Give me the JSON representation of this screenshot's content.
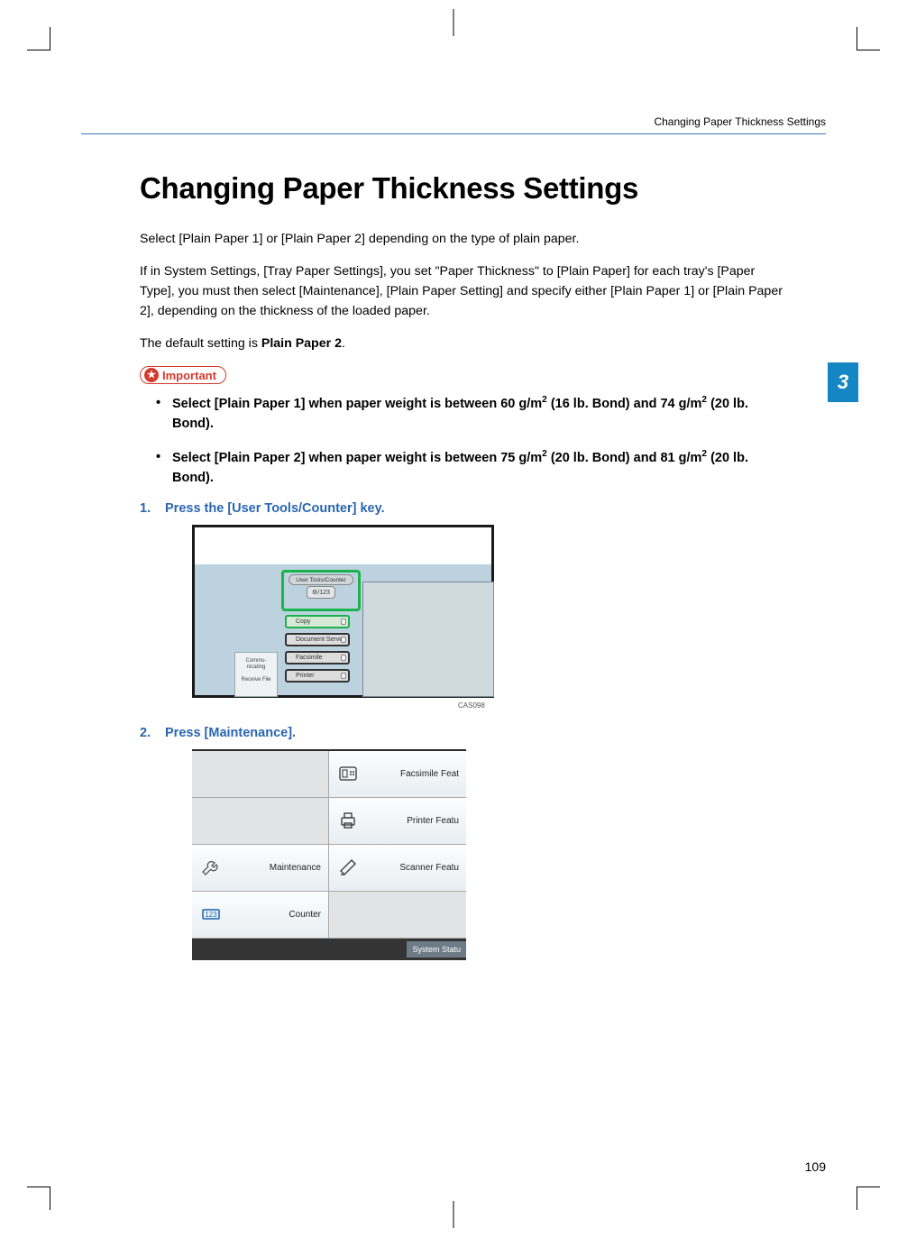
{
  "running_head": "Changing Paper Thickness Settings",
  "title": "Changing Paper Thickness Settings",
  "para1": "Select [Plain Paper 1] or [Plain Paper 2] depending on the type of plain paper.",
  "para2": "If in System Settings, [Tray Paper Settings], you set \"Paper Thickness\" to [Plain Paper] for each tray's [Paper Type], you must then select [Maintenance], [Plain Paper Setting] and specify either [Plain Paper 1] or [Plain Paper 2], depending on the thickness of the loaded paper.",
  "para3_prefix": "The default setting is ",
  "para3_bold": "Plain Paper 2",
  "para3_suffix": ".",
  "important_label": "Important",
  "important_items": [
    {
      "text_a": "Select [Plain Paper 1] when paper weight is between 60 g/m",
      "text_b": " (16 lb. Bond) and 74 g/m",
      "text_c": " (20 lb. Bond)."
    },
    {
      "text_a": "Select [Plain Paper 2] when paper weight is between 75 g/m",
      "text_b": " (20 lb. Bond) and 81 g/m",
      "text_c": " (20 lb. Bond)."
    }
  ],
  "steps": [
    {
      "title": "Press the [User Tools/Counter] key."
    },
    {
      "title": "Press [Maintenance]."
    }
  ],
  "fig1": {
    "tool_label": "User Tools/Counter",
    "icon_label": "⚙/123",
    "buttons": [
      "Copy",
      "Document Server",
      "Facsimile",
      "Printer"
    ],
    "left_labels": {
      "commu": "Commu-\nnicating",
      "recv": "Receive File"
    },
    "caption": "CAS098"
  },
  "fig2": {
    "cells": {
      "facsimile": "Facsimile Feat",
      "printer": "Printer Featu",
      "maintenance": "Maintenance",
      "scanner": "Scanner Featu",
      "counter": "Counter"
    },
    "status": "System Statu"
  },
  "side_tab": "3",
  "page_number": "109"
}
